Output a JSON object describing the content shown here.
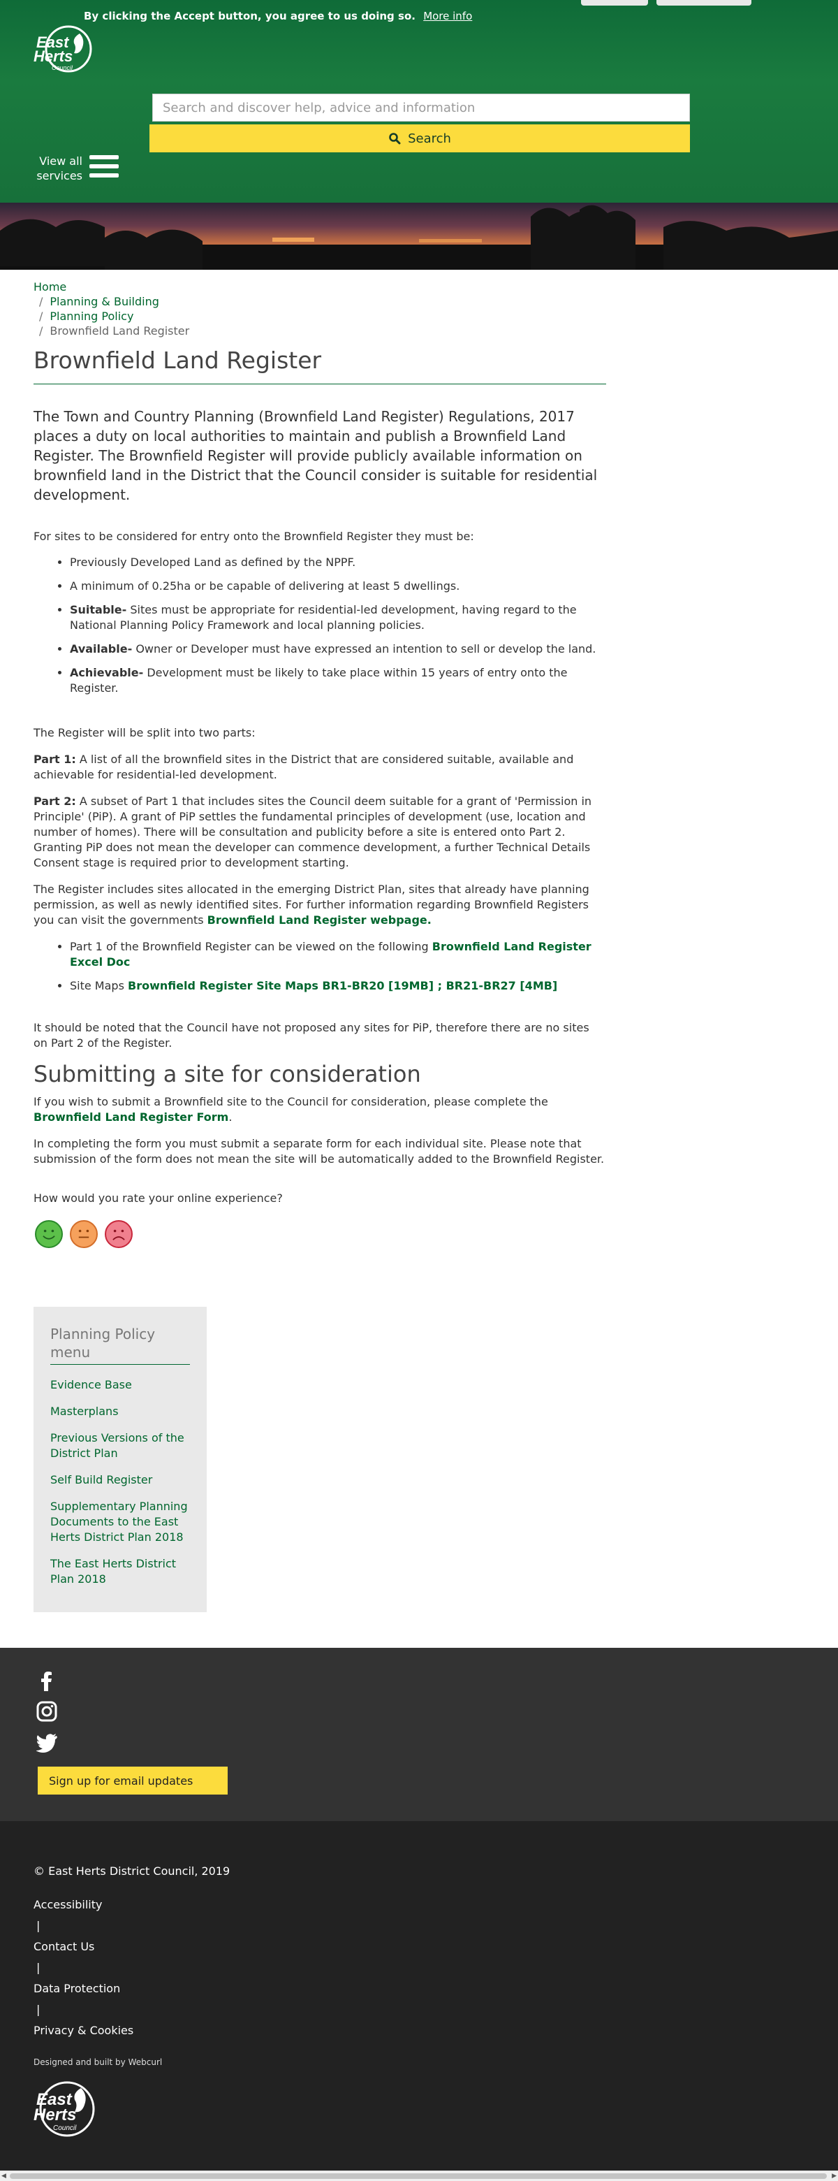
{
  "cookie": {
    "text": "By clicking the Accept button, you agree to us doing so.",
    "more_info": "More info"
  },
  "logo": {
    "line1": "East",
    "line2": "Herts",
    "line3": "Council"
  },
  "search": {
    "placeholder": "Search and discover help, advice and information",
    "button": "Search"
  },
  "nav": {
    "view_all": "View all services"
  },
  "breadcrumb": {
    "home": "Home",
    "level1": "Planning & Building",
    "level2": "Planning Policy",
    "current": "Brownfield Land Register",
    "separator": "/"
  },
  "page": {
    "title": "Brownfield Land Register",
    "lead": "The Town and Country Planning (Brownfield Land Register) Regulations, 2017 places a duty on local authorities to maintain and publish a Brownfield Land Register. The Brownfield Register will provide publicly available information on brownfield land in the District that the Council consider is suitable for residential development.",
    "criteria_intro": "For sites to be considered for entry onto the Brownfield Register they must be:",
    "criteria": [
      {
        "bold": "",
        "text": "Previously Developed Land as defined by the NPPF."
      },
      {
        "bold": "",
        "text": "A minimum of 0.25ha or be capable of delivering at least 5 dwellings."
      },
      {
        "bold": "Suitable-",
        "text": " Sites must be appropriate for residential-led development, having regard to the National Planning Policy Framework and local planning policies."
      },
      {
        "bold": "Available-",
        "text": " Owner or Developer must have expressed an intention to sell or develop the land."
      },
      {
        "bold": "Achievable-",
        "text": " Development must be likely to take place within 15 years of entry onto the Register."
      }
    ],
    "split_intro": "The Register will be split into two parts:",
    "part1_label": "Part 1:",
    "part1_text": " A list of all the brownfield sites in the District that are considered suitable, available and achievable for residential-led development.",
    "part2_label": "Part 2:",
    "part2_text": " A subset of Part 1 that includes sites the Council deem suitable for a grant of 'Permission in Principle' (PiP). A grant of PiP settles the fundamental principles of development (use, location and number of homes). There will be consultation and publicity before a site is entered onto Part 2. Granting PiP does not mean the developer can commence development, a further Technical Details Consent stage is required prior to development starting.",
    "includes_text": "The Register includes sites allocated in the emerging District Plan, sites that already have planning permission, as well as newly identified sites. For further information regarding Brownfield Registers you can visit the governments ",
    "gov_link": "Brownfield Land Register webpage.",
    "link1_text": "Part 1 of the Brownfield Register can be viewed on the following ",
    "link1": "Brownfield Land Register Excel Doc",
    "link2_text": "Site Maps ",
    "link2": "Brownfield Register Site Maps BR1-BR20 [19MB] ; BR21-BR27 [4MB]",
    "note": "It should be noted that the Council have not proposed any sites for PiP, therefore there are no sites on Part 2 of the Register.",
    "section_heading": "Submitting a site for consideration",
    "submit_text": "If you wish to submit a Brownfield site to the Council for consideration, please complete the ",
    "submit_link": "Brownfield Land Register Form",
    "submit_end": ".",
    "form_note": "In completing the form you must submit a separate form for each individual site. Please note that submission of the form does not mean the site will be automatically added to the Brownfield Register.",
    "rating_label": "How would you rate your online experience?"
  },
  "side_menu": {
    "title": "Planning Policy menu",
    "items": [
      "Evidence Base",
      "Masterplans",
      "Previous Versions of the District Plan",
      "Self Build Register",
      "Supplementary Planning Documents to the East Herts District Plan 2018",
      "The East Herts District Plan 2018"
    ]
  },
  "footer": {
    "email_signup": "Sign up for email updates",
    "copyright": "© East Herts District Council, 2019",
    "links": [
      "Accessibility",
      "Contact Us",
      "Data Protection",
      "Privacy & Cookies"
    ],
    "separator": "|",
    "credits": "Designed and built by Webcurl"
  },
  "colors": {
    "brand_green": "#00662e",
    "accent_yellow": "#fcdc3d",
    "footer_dark": "#222222",
    "footer_mid": "#333333"
  }
}
